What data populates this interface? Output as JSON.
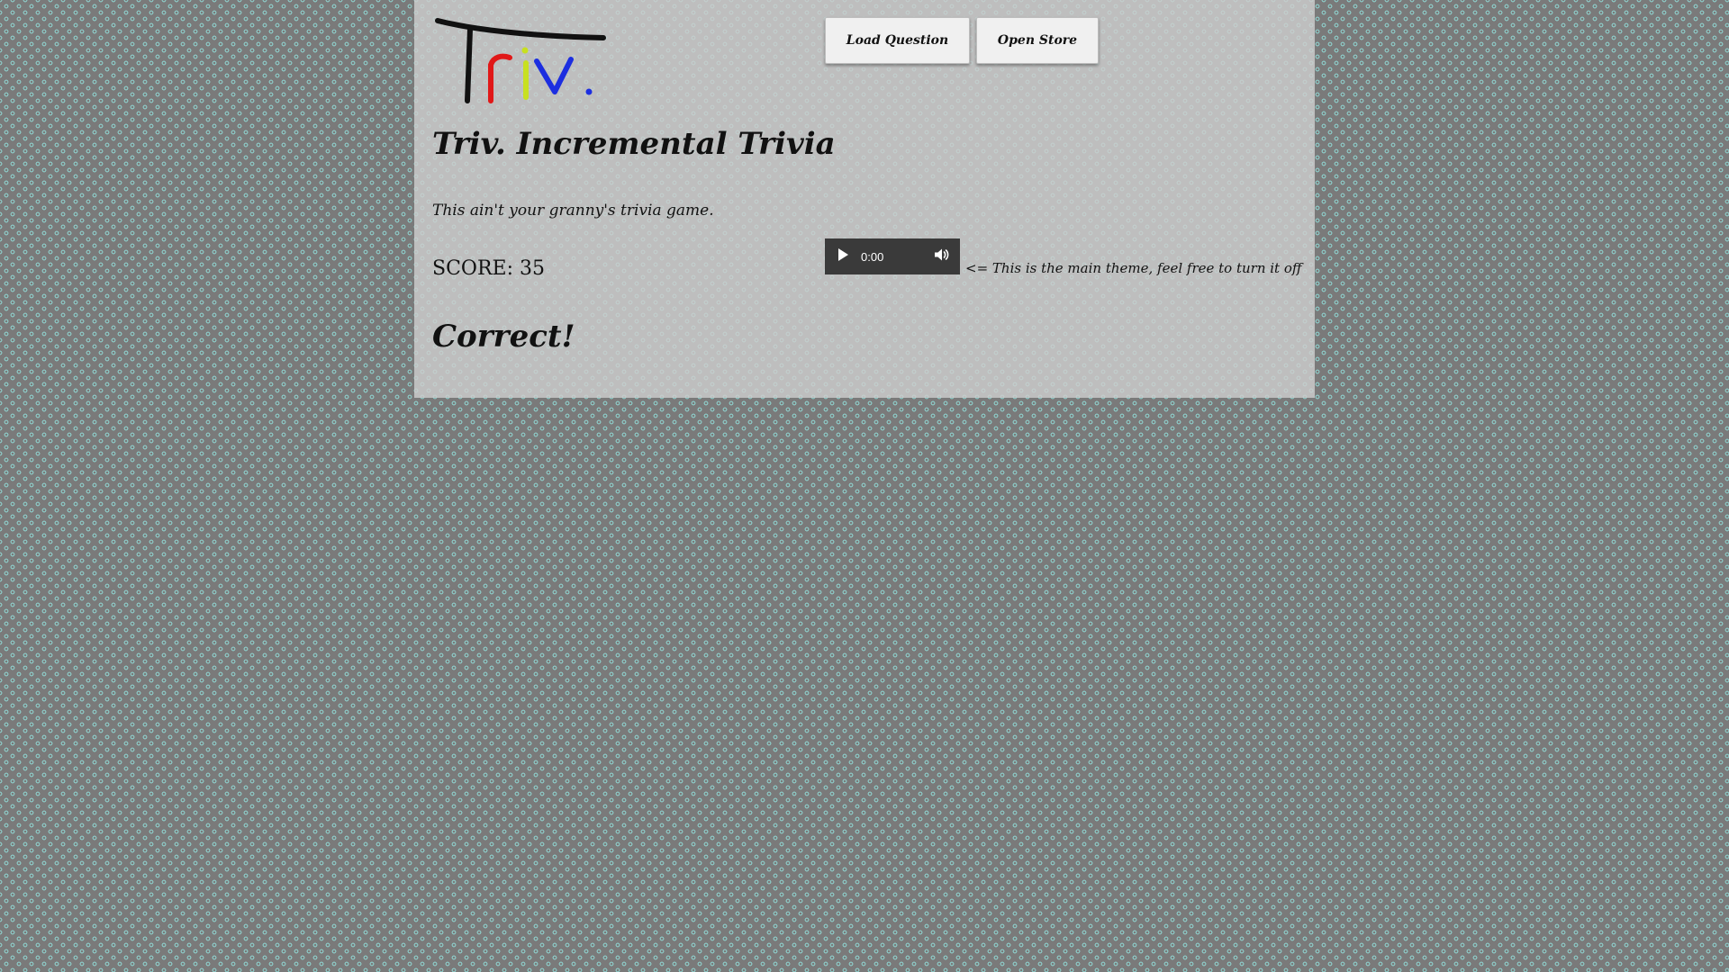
{
  "logo": {
    "text": "Triv.",
    "letter_colors": [
      "#111111",
      "#e01818",
      "#c8e020",
      "#1c2ee0",
      "#1c2ee0"
    ]
  },
  "toolbar": {
    "load_question_label": "Load Question",
    "open_store_label": "Open Store"
  },
  "header": {
    "title": "Triv. Incremental Trivia",
    "tagline": "This ain't your granny's trivia game."
  },
  "score": {
    "text": "SCORE: 35"
  },
  "audio": {
    "time": "0:00",
    "note": "<= This is the main theme, feel free to turn it off"
  },
  "feedback": {
    "text": "Correct!"
  },
  "colors": {
    "background": "#7a7a7a",
    "dot_pattern": "#8fd6d2",
    "panel": "#cdcdcd",
    "audio_bar": "#3a3a3a"
  },
  "icons": {
    "play": "play-icon",
    "volume": "volume-icon"
  }
}
